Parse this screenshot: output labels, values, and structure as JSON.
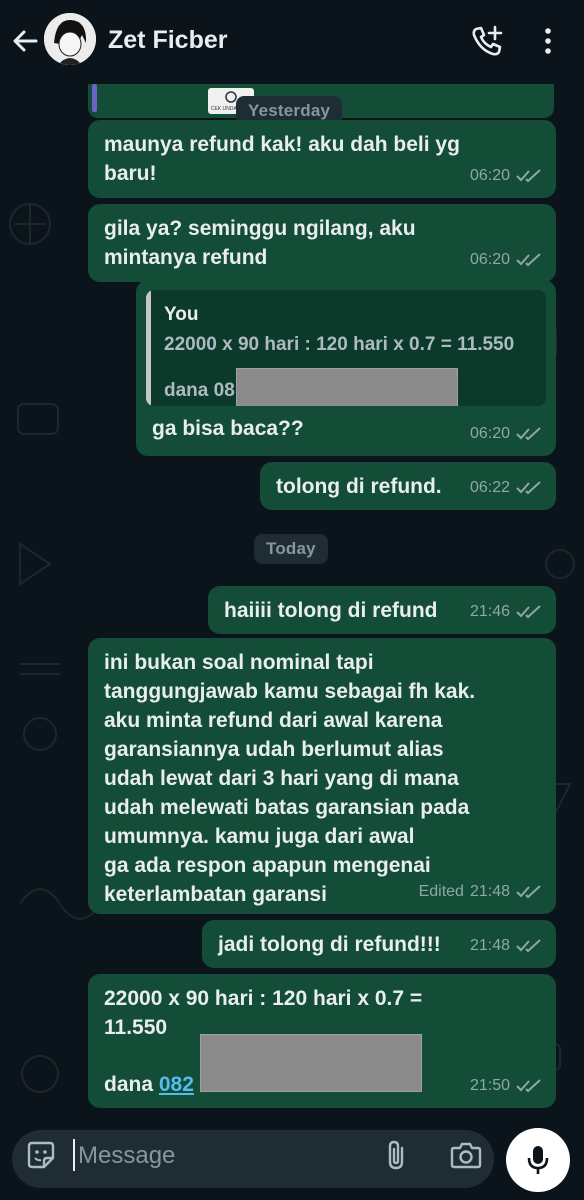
{
  "header": {
    "contact_name": "Zet Ficber"
  },
  "chat": {
    "date_yesterday": "Yesterday",
    "date_today": "Today",
    "top_quote_thumb_text": "CEK UNDANGAN",
    "messages": [
      {
        "text": "maunya refund kak! aku dah beli yg\nbaru!",
        "time": "06:20"
      },
      {
        "text": "gila ya? seminggu ngilang, aku\nmintanya refund",
        "time": "06:20"
      },
      {
        "quote_author": "You",
        "quote_line1": "22000 x 90 hari : 120 hari x 0.7 = 11.550",
        "quote_line2": "dana 08",
        "text": "ga bisa baca??",
        "time": "06:20"
      },
      {
        "text": "tolong di refund.",
        "time": "06:22"
      },
      {
        "text": "haiiii tolong di refund",
        "time": "21:46"
      },
      {
        "text": "ini bukan soal nominal tapi\ntanggungjawab kamu sebagai fh kak.\naku minta refund dari awal karena\ngaransiannya udah berlumut alias\nudah lewat dari 3 hari yang di mana\nudah melewati batas garansian pada\numumnya. kamu juga dari awal\nga ada respon apapun mengenai\nketerlambatan garansi",
        "edited": "Edited",
        "time": "21:48"
      },
      {
        "text": "jadi tolong di refund!!!",
        "time": "21:48"
      },
      {
        "text": "22000 x 90 hari : 120 hari x 0.7 =\n11.550",
        "text2": "dana ",
        "link": "082",
        "time": "21:50"
      }
    ]
  },
  "composer": {
    "placeholder": "Message"
  },
  "colors": {
    "bubble": "#134d37",
    "background": "#0b141a",
    "tick": "#8fa8a0",
    "link": "#53bdeb"
  },
  "icons": [
    "back-arrow-icon",
    "call-add-icon",
    "more-vert-icon",
    "sticker-icon",
    "attach-icon",
    "camera-icon",
    "mic-icon",
    "double-check-icon"
  ]
}
